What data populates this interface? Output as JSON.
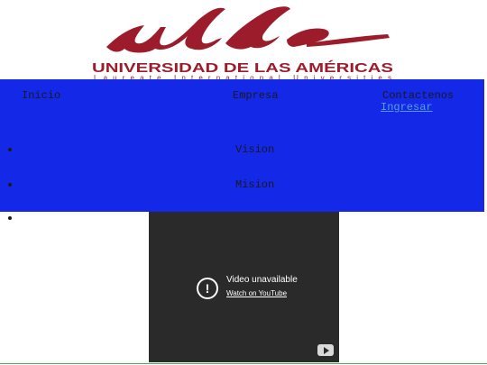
{
  "logo": {
    "monogram": "udla",
    "name": "UNIVERSIDAD DE LAS AMÉRICAS",
    "tagline": "Laureate International Universities",
    "brand_color": "#9c1c2c",
    "tagline_color": "#9c1c2c"
  },
  "nav": {
    "background": "#1428e8",
    "items": [
      {
        "label": "Inicio"
      },
      {
        "label": "Empresa"
      },
      {
        "label": "Contactenos"
      }
    ],
    "login_label": "Ingresar",
    "submenu": [
      {
        "label": "Vision"
      },
      {
        "label": "Mision"
      }
    ]
  },
  "video": {
    "title": "Video unavailable",
    "link": "Watch on YouTube",
    "icon": "alert-circle-icon",
    "badge_icon": "youtube-icon"
  }
}
